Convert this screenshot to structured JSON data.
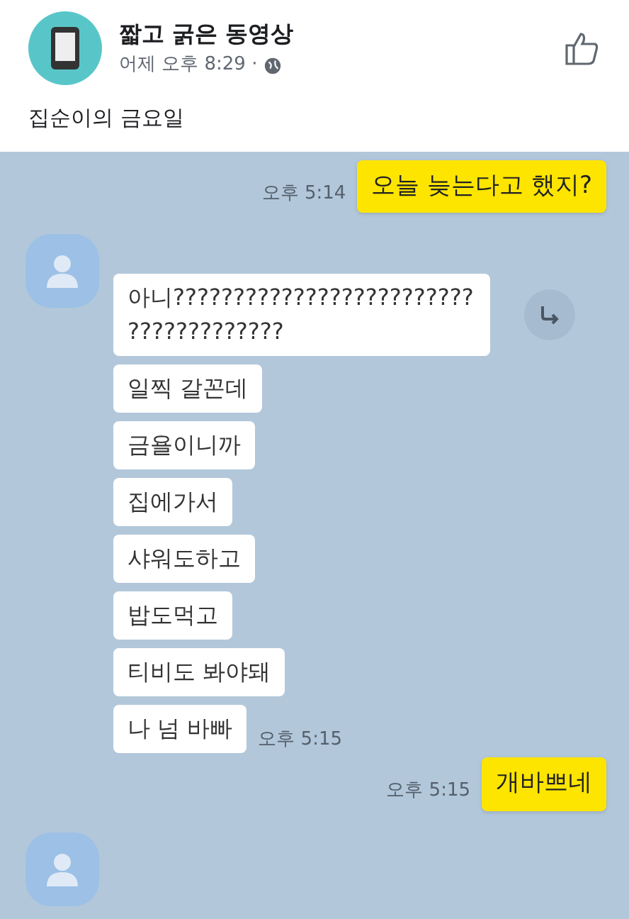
{
  "post": {
    "author": "짧고 굵은 동영상",
    "time": "어제 오후 8:29 ·",
    "caption": "집순이의 금요일"
  },
  "messages": [
    {
      "kind": "sent",
      "bubbles": [
        "오늘 늦는다고 했지?"
      ],
      "time": "오후 5:14"
    },
    {
      "kind": "received",
      "bubbles": [
        "아니??????????????????????????????????????",
        "일찍 갈꼰데",
        "금욜이니까",
        "집에가서",
        "샤워도하고",
        "밥도먹고",
        "티비도 봐야돼",
        "나 넘 바빠"
      ],
      "time": "오후 5:15"
    },
    {
      "kind": "sent",
      "bubbles": [
        "개바쁘네"
      ],
      "time": "오후 5:15"
    },
    {
      "kind": "received"
    }
  ]
}
